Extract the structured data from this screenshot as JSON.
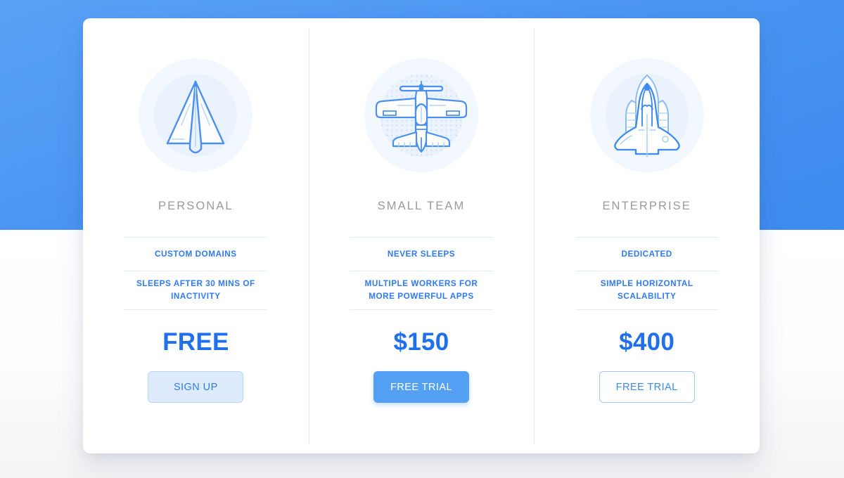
{
  "theme": {
    "brand_blue": "#3d8bef",
    "accent_blue": "#2f7af3",
    "price_blue": "#1f6fee",
    "title_gray": "#9a9a9a",
    "divider": "#e4eef9",
    "card_bg": "#ffffff",
    "page_bg_band": "#4b95f2"
  },
  "plans": [
    {
      "id": "personal",
      "icon": "paper-plane-icon",
      "title": "PERSONAL",
      "features": [
        "CUSTOM DOMAINS",
        "SLEEPS AFTER 30 MINS OF INACTIVITY"
      ],
      "price": "FREE",
      "cta_label": "SIGN UP",
      "cta_style": "soft"
    },
    {
      "id": "small-team",
      "icon": "propeller-plane-icon",
      "title": "SMALL TEAM",
      "features": [
        "NEVER SLEEPS",
        "MULTIPLE WORKERS FOR MORE POWERFUL APPS"
      ],
      "price": "$150",
      "cta_label": "FREE TRIAL",
      "cta_style": "solid"
    },
    {
      "id": "enterprise",
      "icon": "space-shuttle-icon",
      "title": "ENTERPRISE",
      "features": [
        "DEDICATED",
        "SIMPLE HORIZONTAL SCALABILITY"
      ],
      "price": "$400",
      "cta_label": "FREE TRIAL",
      "cta_style": "outline"
    }
  ]
}
